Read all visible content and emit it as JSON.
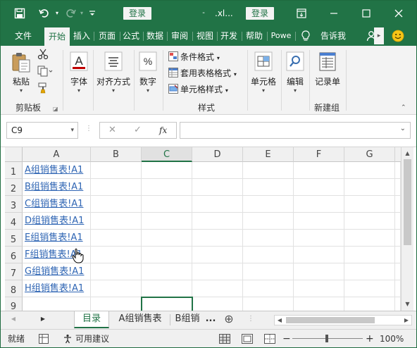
{
  "titlebar": {
    "login_label": "登录",
    "file_name": ".xl...",
    "login_label_2": "登录",
    "customize_icon": "chevron-down-icon"
  },
  "tabs": [
    "文件",
    "开始",
    "插入",
    "页面",
    "公式",
    "数据",
    "审阅",
    "视图",
    "开发",
    "帮助",
    "Powe"
  ],
  "tell_me": "告诉我",
  "ribbon": {
    "paste_label": "粘贴",
    "clipboard_label": "剪贴板",
    "font_label": "字体",
    "align_label": "对齐方式",
    "number_label": "数字",
    "cond_format_label": "条件格式",
    "table_format_label": "套用表格格式",
    "cell_style_label": "单元格样式",
    "styles_label": "样式",
    "cells_label": "单元格",
    "edit_label": "编辑",
    "form_label": "记录单",
    "newgroup_label": "新建组"
  },
  "formula_bar": {
    "name_box": "C9",
    "fx_label": "fx",
    "cancel_glyph": "✕",
    "enter_glyph": "✓",
    "value": ""
  },
  "columns": [
    "A",
    "B",
    "C",
    "D",
    "E",
    "F",
    "G"
  ],
  "rows": [
    "1",
    "2",
    "3",
    "4",
    "5",
    "6",
    "7",
    "8",
    "9"
  ],
  "links": [
    "A组销售表!A1",
    "B组销售表!A1",
    "C组销售表!A1",
    "D组销售表!A1",
    "E组销售表!A1",
    "F组销售表!A1",
    "G组销售表!A1",
    "H组销售表!A1"
  ],
  "sheets": {
    "active": "目录",
    "tab2": "A组销售表",
    "tab3": "B组销",
    "more": "...",
    "add": "⊕"
  },
  "status": {
    "ready": "就绪",
    "accessibility": "可用建议",
    "zoom_minus": "−",
    "zoom_plus": "+",
    "zoom": "100%"
  },
  "colors": {
    "accent": "#217346",
    "link": "#3066b4"
  }
}
